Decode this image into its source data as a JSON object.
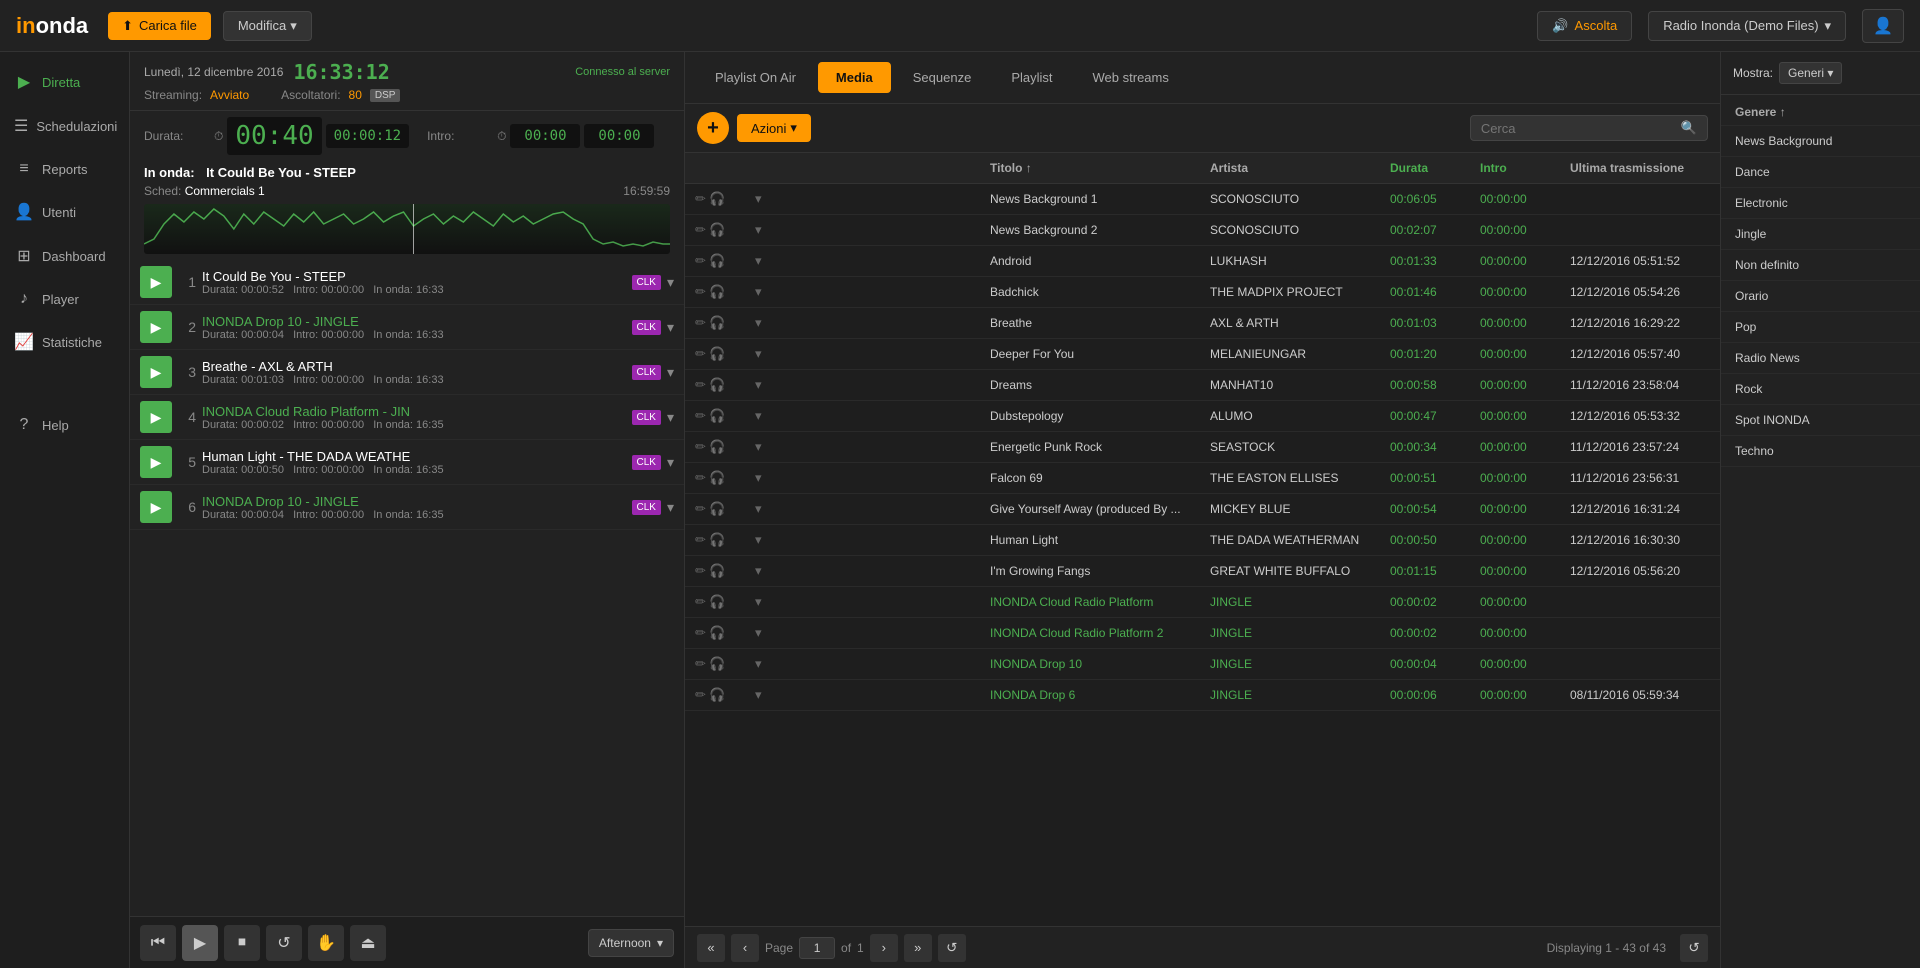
{
  "topbar": {
    "logo": "inonda",
    "upload_label": "Carica file",
    "modifica_label": "Modifica",
    "ascolta_label": "Ascolta",
    "radio_name": "Radio Inonda (Demo Files)",
    "user_icon": "👤"
  },
  "sidebar": {
    "items": [
      {
        "label": "Diretta",
        "icon": "▶",
        "active": true
      },
      {
        "label": "Schedulazioni",
        "icon": "📅"
      },
      {
        "label": "Reports",
        "icon": "≡"
      },
      {
        "label": "Utenti",
        "icon": "👤"
      },
      {
        "label": "Dashboard",
        "icon": "⊞"
      },
      {
        "label": "Player",
        "icon": "♪"
      },
      {
        "label": "Statistiche",
        "icon": "📈"
      },
      {
        "label": "Help",
        "icon": "?"
      }
    ]
  },
  "left_panel": {
    "date": "Lunedì, 12 dicembre 2016",
    "time": "16:33:12",
    "connected": "Connesso al server",
    "streaming_label": "Streaming:",
    "streaming_status": "Avviato",
    "listeners_label": "Ascoltatori:",
    "listeners_count": "80",
    "dsp": "DSP",
    "durata_label": "Durata:",
    "time_durata": "00:40",
    "time_durata_extra": "00:00:12",
    "intro_label": "Intro:",
    "time_intro": "00:00",
    "time_intro2": "00:00",
    "in_onda_label": "In onda:",
    "in_onda_title": "It Could Be You - STEEP",
    "sched_label": "Sched:",
    "sched_name": "Commercials 1",
    "sched_time": "16:59:59",
    "playlist": [
      {
        "num": 1,
        "title": "It Could Be You - STEEP",
        "dur": "00:00:52",
        "intro": "00:00:00",
        "on_air": "16:33",
        "jingle": false
      },
      {
        "num": 2,
        "title": "INONDA Drop 10 - JINGLE",
        "dur": "00:00:04",
        "intro": "00:00:00",
        "on_air": "16:33",
        "jingle": true
      },
      {
        "num": 3,
        "title": "Breathe - AXL & ARTH",
        "dur": "00:01:03",
        "intro": "00:00:00",
        "on_air": "16:33",
        "jingle": false
      },
      {
        "num": 4,
        "title": "INONDA Cloud Radio Platform - JIN",
        "dur": "00:00:02",
        "intro": "00:00:00",
        "on_air": "16:35",
        "jingle": true
      },
      {
        "num": 5,
        "title": "Human Light - THE DADA WEATHE",
        "dur": "00:00:50",
        "intro": "00:00:00",
        "on_air": "16:35",
        "jingle": false
      },
      {
        "num": 6,
        "title": "INONDA Drop 10 - JINGLE",
        "dur": "00:00:04",
        "intro": "00:00:00",
        "on_air": "16:35",
        "jingle": true
      }
    ],
    "transport": {
      "dropdown": "Afternoon"
    }
  },
  "tabs": [
    {
      "label": "Playlist On Air",
      "active": false
    },
    {
      "label": "Media",
      "active": true
    },
    {
      "label": "Sequenze",
      "active": false
    },
    {
      "label": "Playlist",
      "active": false
    },
    {
      "label": "Web streams",
      "active": false
    }
  ],
  "toolbar": {
    "add_label": "+",
    "azioni_label": "Azioni",
    "search_placeholder": "Cerca"
  },
  "table": {
    "headers": [
      "",
      "",
      "Titolo ↑",
      "Artista",
      "Durata",
      "Intro",
      "Ultima trasmissione"
    ],
    "rows": [
      {
        "title": "News Background 1",
        "artist": "SCONOSCIUTO",
        "dur": "00:06:05",
        "intro": "00:00:00",
        "last": "",
        "jingle": false
      },
      {
        "title": "News Background 2",
        "artist": "SCONOSCIUTO",
        "dur": "00:02:07",
        "intro": "00:00:00",
        "last": "",
        "jingle": false
      },
      {
        "title": "Android",
        "artist": "LUKHASH",
        "dur": "00:01:33",
        "intro": "00:00:00",
        "last": "12/12/2016 05:51:52",
        "jingle": false
      },
      {
        "title": "Badchick",
        "artist": "THE MADPIX PROJECT",
        "dur": "00:01:46",
        "intro": "00:00:00",
        "last": "12/12/2016 05:54:26",
        "jingle": false
      },
      {
        "title": "Breathe",
        "artist": "AXL & ARTH",
        "dur": "00:01:03",
        "intro": "00:00:00",
        "last": "12/12/2016 16:29:22",
        "jingle": false
      },
      {
        "title": "Deeper For You",
        "artist": "MELANIEUNGAR",
        "dur": "00:01:20",
        "intro": "00:00:00",
        "last": "12/12/2016 05:57:40",
        "jingle": false
      },
      {
        "title": "Dreams",
        "artist": "MANHAT10",
        "dur": "00:00:58",
        "intro": "00:00:00",
        "last": "11/12/2016 23:58:04",
        "jingle": false
      },
      {
        "title": "Dubstepology",
        "artist": "ALUMO",
        "dur": "00:00:47",
        "intro": "00:00:00",
        "last": "12/12/2016 05:53:32",
        "jingle": false
      },
      {
        "title": "Energetic Punk Rock",
        "artist": "SEASTOCK",
        "dur": "00:00:34",
        "intro": "00:00:00",
        "last": "11/12/2016 23:57:24",
        "jingle": false
      },
      {
        "title": "Falcon 69",
        "artist": "THE EASTON ELLISES",
        "dur": "00:00:51",
        "intro": "00:00:00",
        "last": "11/12/2016 23:56:31",
        "jingle": false
      },
      {
        "title": "Give Yourself Away (produced By ...",
        "artist": "MICKEY BLUE",
        "dur": "00:00:54",
        "intro": "00:00:00",
        "last": "12/12/2016 16:31:24",
        "jingle": false
      },
      {
        "title": "Human Light",
        "artist": "THE DADA WEATHERMAN",
        "dur": "00:00:50",
        "intro": "00:00:00",
        "last": "12/12/2016 16:30:30",
        "jingle": false
      },
      {
        "title": "I'm Growing Fangs",
        "artist": "GREAT WHITE BUFFALO",
        "dur": "00:01:15",
        "intro": "00:00:00",
        "last": "12/12/2016 05:56:20",
        "jingle": false
      },
      {
        "title": "INONDA Cloud Radio Platform",
        "artist": "JINGLE",
        "dur": "00:00:02",
        "intro": "00:00:00",
        "last": "",
        "jingle": true
      },
      {
        "title": "INONDA Cloud Radio Platform 2",
        "artist": "JINGLE",
        "dur": "00:00:02",
        "intro": "00:00:00",
        "last": "",
        "jingle": true
      },
      {
        "title": "INONDA Drop 10",
        "artist": "JINGLE",
        "dur": "00:00:04",
        "intro": "00:00:00",
        "last": "",
        "jingle": true
      },
      {
        "title": "INONDA Drop 6",
        "artist": "JINGLE",
        "dur": "00:00:06",
        "intro": "00:00:00",
        "last": "08/11/2016 05:59:34",
        "jingle": true
      }
    ]
  },
  "pagination": {
    "page_label": "Page",
    "page_num": "1",
    "of_label": "of",
    "total_pages": "1",
    "info": "Displaying 1 - 43 of 43"
  },
  "right_panel": {
    "mostra_label": "Mostra:",
    "dropdown_label": "Generi",
    "genre_header": "Genere ↑",
    "genres": [
      "News Background",
      "Dance",
      "Electronic",
      "Jingle",
      "Non definito",
      "Orario",
      "Pop",
      "Radio News",
      "Rock",
      "Spot INONDA",
      "Techno"
    ]
  }
}
